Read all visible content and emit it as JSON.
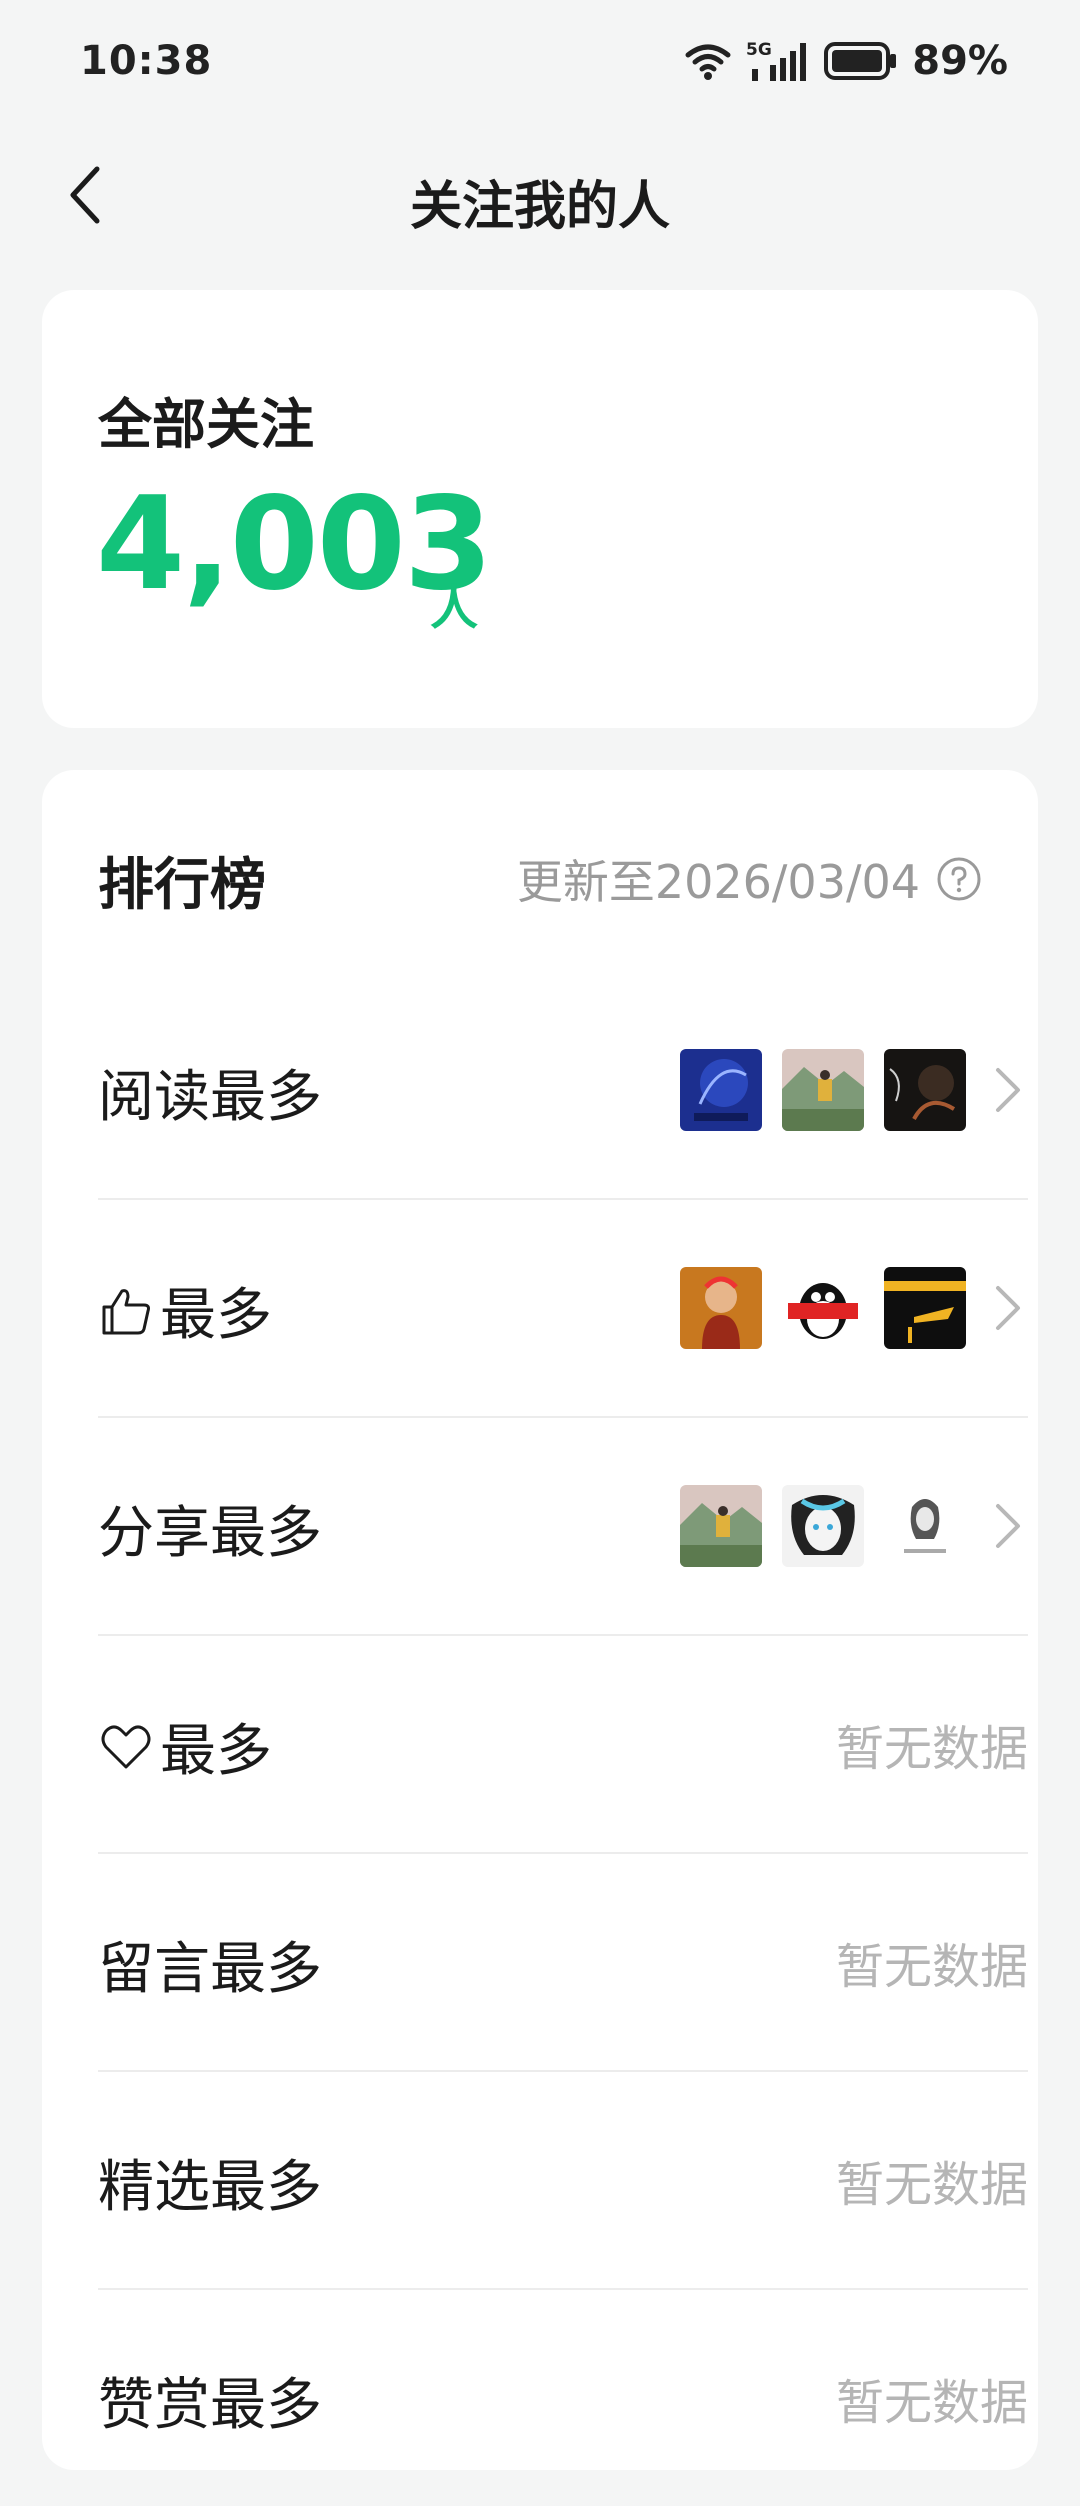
{
  "status_bar": {
    "time": "10:38",
    "network": "5G",
    "battery": "89%",
    "icons": [
      "wifi-icon",
      "signal-icon",
      "battery-icon"
    ]
  },
  "navbar": {
    "title": "关注我的人",
    "back_icon": "back-arrow-icon"
  },
  "summary": {
    "label": "全部关注",
    "count": "4,003",
    "unit": "人",
    "accent_color": "#13c27a"
  },
  "ranking": {
    "title": "排行榜",
    "updated": "更新至2026/03/04",
    "help_icon": "help-circle-icon",
    "rows": [
      {
        "label": "阅读最多",
        "icon": "",
        "has_thumbs": true
      },
      {
        "label": "最多",
        "icon": "thumbs-up-icon",
        "has_thumbs": true
      },
      {
        "label": "分享最多",
        "icon": "",
        "has_thumbs": true
      },
      {
        "label": "最多",
        "icon": "heart-icon",
        "no_data": "暂无数据"
      },
      {
        "label": "留言最多",
        "icon": "",
        "no_data": "暂无数据"
      },
      {
        "label": "精选最多",
        "icon": "",
        "no_data": "暂无数据"
      },
      {
        "label": "赞赏最多",
        "icon": "",
        "no_data": "暂无数据"
      }
    ]
  }
}
